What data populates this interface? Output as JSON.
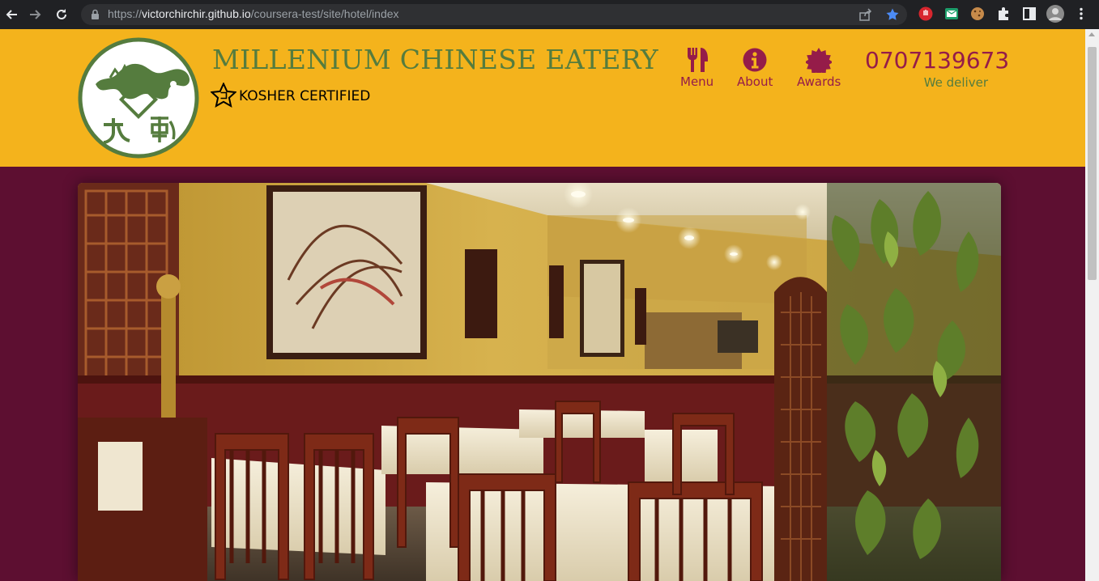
{
  "browser": {
    "url_prefix": "https://",
    "url_host": "victorchirchir.github.io",
    "url_path": "/coursera-test/site/hotel/index",
    "icons": [
      "back-icon",
      "forward-icon",
      "reload-icon",
      "lock-icon",
      "share-icon",
      "bookmark-star-icon",
      "extension-icons",
      "puzzle-icon",
      "sidepanel-icon",
      "profile-avatar",
      "menu-kebab-icon"
    ]
  },
  "header": {
    "title": "MILLENIUM CHINESE EATERY",
    "kosher_label": "KOSHER CERTIFIED",
    "nav": [
      {
        "label": "Menu",
        "icon": "cutlery-icon"
      },
      {
        "label": "About",
        "icon": "info-icon"
      },
      {
        "label": "Awards",
        "icon": "certificate-icon"
      }
    ],
    "phone": "0707139673",
    "phone_note": "We deliver"
  },
  "colors": {
    "header_bg": "#f4b31c",
    "page_bg": "#5d0f31",
    "title_green": "#557c3e",
    "accent_maroon": "#951c49"
  },
  "hero": {
    "subject": "restaurant-interior-photo"
  }
}
